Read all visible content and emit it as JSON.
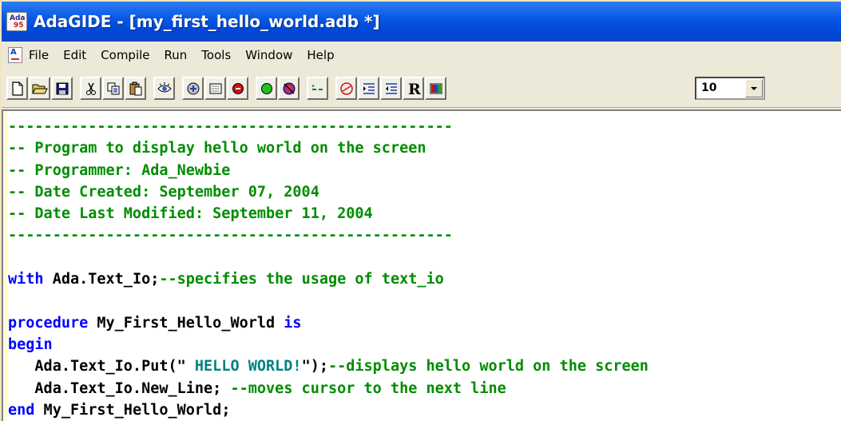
{
  "window": {
    "title": "AdaGIDE - [my_first_hello_world.adb *]",
    "icon": "ada95-app-icon",
    "icon_text_top": "Ada",
    "icon_text_bottom": "95"
  },
  "menu": {
    "items": [
      "File",
      "Edit",
      "Compile",
      "Run",
      "Tools",
      "Window",
      "Help"
    ]
  },
  "toolbar": {
    "buttons": [
      "new-file-icon",
      "open-folder-icon",
      "save-disk-icon",
      "cut-scissors-icon",
      "copy-icon",
      "paste-icon",
      "preview-eye-icon",
      "compile-icon",
      "build-icon",
      "stop-icon",
      "run-icon",
      "debug-icon",
      "comment-icon",
      "uncomment-icon",
      "indent-icon",
      "outdent-icon",
      "reformat-R-icon",
      "colors-icon"
    ],
    "font_size_value": "10"
  },
  "editor": {
    "lines": [
      [
        {
          "t": "--------------------------------------------------",
          "c": "cm"
        }
      ],
      [
        {
          "t": "-- Program to display hello world on the screen",
          "c": "cm"
        }
      ],
      [
        {
          "t": "-- Programmer: Ada_Newbie",
          "c": "cm"
        }
      ],
      [
        {
          "t": "-- Date Created: September 07, 2004",
          "c": "cm"
        }
      ],
      [
        {
          "t": "-- Date Last Modified: September 11, 2004",
          "c": "cm"
        }
      ],
      [
        {
          "t": "--------------------------------------------------",
          "c": "cm"
        }
      ],
      [
        {
          "t": "",
          "c": "nm"
        }
      ],
      [
        {
          "t": "with",
          "c": "kw"
        },
        {
          "t": " Ada.Text_Io;",
          "c": "nm"
        },
        {
          "t": "--specifies the usage of text_io",
          "c": "cm"
        }
      ],
      [
        {
          "t": "",
          "c": "nm"
        }
      ],
      [
        {
          "t": "procedure",
          "c": "kw"
        },
        {
          "t": " My_First_Hello_World ",
          "c": "nm"
        },
        {
          "t": "is",
          "c": "kw"
        }
      ],
      [
        {
          "t": "begin",
          "c": "kw"
        }
      ],
      [
        {
          "t": "   Ada.Text_Io.Put(\"",
          "c": "nm"
        },
        {
          "t": " HELLO WORLD!",
          "c": "st"
        },
        {
          "t": "\");",
          "c": "nm"
        },
        {
          "t": "--displays hello world on the screen",
          "c": "cm"
        }
      ],
      [
        {
          "t": "   Ada.Text_Io.New_Line; ",
          "c": "nm"
        },
        {
          "t": "--moves cursor to the next line",
          "c": "cm"
        }
      ],
      [
        {
          "t": "end",
          "c": "kw"
        },
        {
          "t": " My_First_Hello_World;",
          "c": "nm"
        }
      ]
    ]
  },
  "colors": {
    "comment": "#008c00",
    "keyword": "#0000ff",
    "string": "#008282",
    "titlebar": "#0a5ae6"
  }
}
